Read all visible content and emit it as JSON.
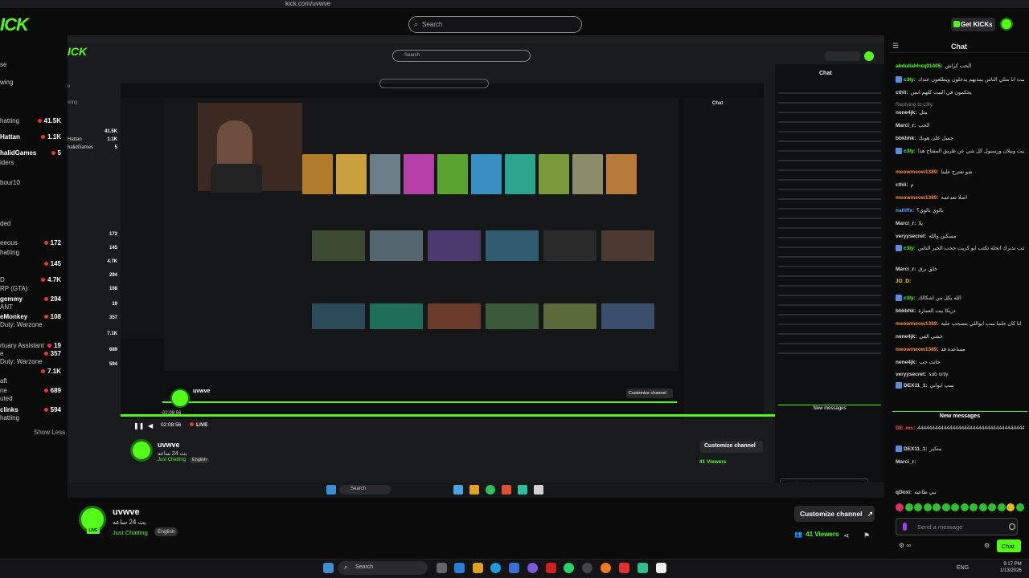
{
  "browser": {
    "url": "kick.com/uvwve"
  },
  "site": {
    "logo": "ICK",
    "search_placeholder": "Search",
    "get_kicks": "Get KICKs"
  },
  "sidebar": {
    "items": [
      {
        "label": "se"
      },
      {
        "label": "wing"
      },
      {
        "label": "hatting",
        "value": "41.5K"
      },
      {
        "label": "Hattan",
        "value": "1.1K"
      },
      {
        "label": "halidGames",
        "value": "5"
      },
      {
        "label": "iders"
      },
      {
        "label": "bour10"
      },
      {
        "label": "ded"
      },
      {
        "label": "eeous",
        "value": "172"
      },
      {
        "label": "hatting"
      },
      {
        "label": "",
        "value": "145"
      },
      {
        "label": "D",
        "value": "4.7K"
      },
      {
        "label": "RP (GTA)"
      },
      {
        "label": "gemmy",
        "value": "294"
      },
      {
        "label": "ANT"
      },
      {
        "label": "eMonkey",
        "value": "108"
      },
      {
        "label": "Duty: Warzone"
      },
      {
        "label": "rtuary Assistant",
        "value": "19"
      },
      {
        "label": "e",
        "value": "357"
      },
      {
        "label": "Duty: Warzone"
      },
      {
        "label": "",
        "value": "7.1K"
      },
      {
        "label": "aft"
      },
      {
        "label": "ne",
        "value": "689"
      },
      {
        "label": "uted"
      },
      {
        "label": "clinks",
        "value": "594"
      },
      {
        "label": "hatting"
      }
    ],
    "show_less": "Show Less"
  },
  "chat": {
    "title": "Chat",
    "messages": [
      {
        "user": "abdullahhxq91405:",
        "text": "الحب كراش",
        "color": "#53fc18"
      },
      {
        "user": "c3ly:",
        "text": "مفتاح البيت انا مثلي الناس يمديهم يدخلون ويطلعون عندك",
        "color": "#53fc18",
        "icon": true
      },
      {
        "user": "cthli:",
        "text": "يحكمون في البيت كلهم انمن",
        "color": "#ddd"
      },
      {
        "user": "",
        "text": "Replying to c3ly:",
        "color": "#888"
      },
      {
        "user": "nene4jk:",
        "text": "مثل",
        "color": "#ddd"
      },
      {
        "user": "Marci_r:",
        "text": "الحب",
        "color": "#ddd"
      },
      {
        "user": "bbkbhk:",
        "text": "جميل على هونك",
        "color": "#ddd"
      },
      {
        "user": "c3ly:",
        "text": "بس يعني راحت بيت وبيلان ورسبول كل شي عن طريق المفتاح هذا",
        "color": "#53fc18",
        "icon": true
      },
      {
        "user": "meowmeow1389:",
        "text": "شو تفترح علينا",
        "color": "#ff8a3d"
      },
      {
        "user": "cthli:",
        "text": "م",
        "color": "#ddd"
      },
      {
        "user": "meowmeow1389:",
        "text": "اصلا تعدعمه",
        "color": "#ff8a3d"
      },
      {
        "user": "nalliffx:",
        "text": "بالوي بالوي؟",
        "color": "#5aa0ff"
      },
      {
        "user": "Marci_r:",
        "text": "يلا",
        "color": "#ddd"
      },
      {
        "user": "veryysecret:",
        "text": "مسكين والله",
        "color": "#ddd"
      },
      {
        "user": "c3ly:",
        "text": "الله يكتب تدبرك انحلة تكتب ابو كريت ححب الخير الناس",
        "color": "#53fc18",
        "icon": true
      },
      {
        "user": "Marci_r:",
        "text": "خلق برق",
        "color": "#ddd"
      },
      {
        "user": "JO_D:",
        "text": "",
        "color": "#ffd23f"
      },
      {
        "user": "c3ly:",
        "text": "الله يكل من اشكالك",
        "color": "#53fc18",
        "icon": true
      },
      {
        "user": "bbkbhk:",
        "text": "دريكا بيت العمارة",
        "color": "#ddd"
      },
      {
        "user": "meowmeow1389:",
        "text": "انا كان حلما سب ابواللي بتسحب عليه",
        "color": "#ff8a3d"
      },
      {
        "user": "nene4jk:",
        "text": "خشي الفي",
        "color": "#ddd"
      },
      {
        "user": "meowmeow1389:",
        "text": "مساعدة قد",
        "color": "#ff8a3d"
      },
      {
        "user": "nene4jk:",
        "text": "حانت حب",
        "color": "#ddd"
      },
      {
        "user": "veryysecret:",
        "text": "sub only",
        "color": "#ddd"
      },
      {
        "user": "DEX11_1:",
        "text": "سب ابواني",
        "color": "#ddd",
        "icon": true
      }
    ],
    "new_messages": "New messages",
    "after": [
      {
        "user": "DE_ms:",
        "text": "4444444444444444444444444444444444444",
        "color": "#ff4d4d"
      },
      {
        "user": "DEX11_1:",
        "text": "متكبر",
        "color": "#ddd",
        "icon": true
      },
      {
        "user": "Marci_r:",
        "text": "",
        "color": "#ddd"
      },
      {
        "user": "qDoxi:",
        "text": "ببي طاعيه",
        "color": "#ddd"
      }
    ],
    "send_placeholder": "Send a message",
    "chat_button": "Chat"
  },
  "channel": {
    "name": "uvwve",
    "title": "بث 24 ساعه",
    "category": "Just Chatting",
    "language": "English",
    "live_badge": "LIVE",
    "customize": "Customize channel",
    "viewers": "41 Viewers"
  },
  "stream_overlay": {
    "time": "02:08:56",
    "live": "LIVE",
    "inner_name": "uvwve",
    "inner_title": "بث 24 ساعه",
    "inner_category": "Just Chatting",
    "inner_language": "English",
    "inner_customize": "Customize channel",
    "inner_viewers": "41 Viewers",
    "inner_chat": "Chat",
    "inner_new_messages": "New messages",
    "inner_send": "Send a message",
    "inner_search": "Search"
  },
  "taskbar": {
    "search": "Search",
    "lang": "ENG",
    "time": "9:17 PM",
    "date": "1/13/2026"
  },
  "colors": {
    "accent": "#53fc18",
    "bg": "#0b0b0c"
  }
}
